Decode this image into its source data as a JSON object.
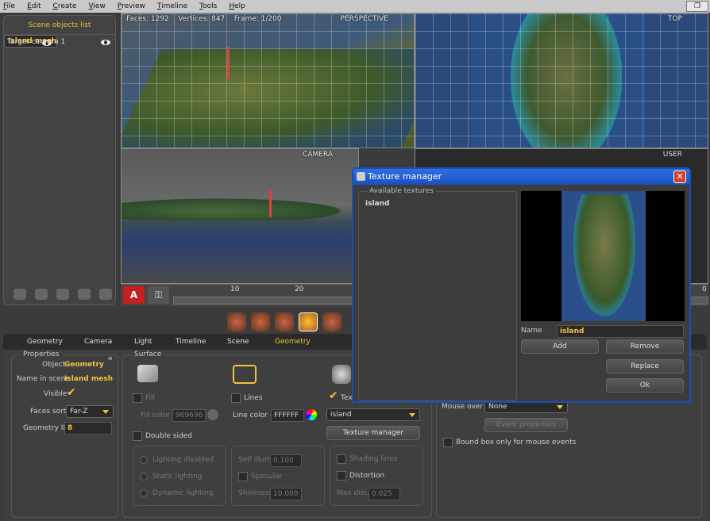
{
  "menu": [
    "File",
    "Edit",
    "Create",
    "View",
    "Preview",
    "Timeline",
    "Tools",
    "Help"
  ],
  "restore_label": "❐",
  "outliner": {
    "title": "Scene objects list",
    "items": [
      {
        "label": "Island mesh",
        "selected": true
      },
      {
        "label": "Target camera 1",
        "selected": false
      }
    ]
  },
  "viewports": {
    "perspective": "PERSPECTIVE",
    "top": "TOP",
    "camera": "CAMERA",
    "user": "USER",
    "faces": "Faces: 1292",
    "vertices": "Vertices: 847",
    "frame": "Frame: 1/200"
  },
  "timeline": {
    "record": "A",
    "ticks": [
      "10",
      "20",
      "0"
    ]
  },
  "tabs": [
    "Geometry",
    "Camera",
    "Light",
    "Timeline",
    "Scene",
    "Geometry"
  ],
  "props": {
    "properties_title": "Properties",
    "object_label": "Object",
    "object_value": "Geometry",
    "name_label": "Name in scene",
    "name_value": "Island mesh",
    "visible_label": "Visible",
    "faces_sort_label": "Faces sort",
    "faces_sort_value": "Far-Z",
    "geometry_id_label": "Geometry ID",
    "geometry_id_value": "8",
    "surface_title": "Surface",
    "fill_label": "Fill",
    "fill_color_label": "Fill color #",
    "fill_color_value": "969696",
    "lines_label": "Lines",
    "line_color_label": "Line color #",
    "line_color_value": "FFFFFF",
    "tex_label": "Tex",
    "tex_select": "island",
    "texture_manager_btn": "Texture manager",
    "double_sided": "Double sided",
    "lighting_disabled": "Lighting disabled",
    "static_lighting": "Static lighting",
    "dynamic_lighting": "Dynamic lighting",
    "self_illum_label": "Self illum.",
    "self_illum_value": "0.100",
    "specular_label": "Specular",
    "shininess_label": "Shininess",
    "shininess_value": "10.000",
    "shading_lines": "Shading lines",
    "distortion": "Distortion",
    "max_dist_label": "Max dist.",
    "max_dist_value": "0.025",
    "mouse_over_label": "Mouse over",
    "mouse_over_value": "None",
    "event_properties": "Event properties",
    "bound_box": "Bound box only for mouse events"
  },
  "dialog": {
    "title": "Texture manager",
    "available": "Available textures",
    "textures": [
      "island"
    ],
    "name_label": "Name",
    "name_value": "island",
    "add": "Add",
    "remove": "Remove",
    "replace": "Replace",
    "ok": "Ok"
  }
}
